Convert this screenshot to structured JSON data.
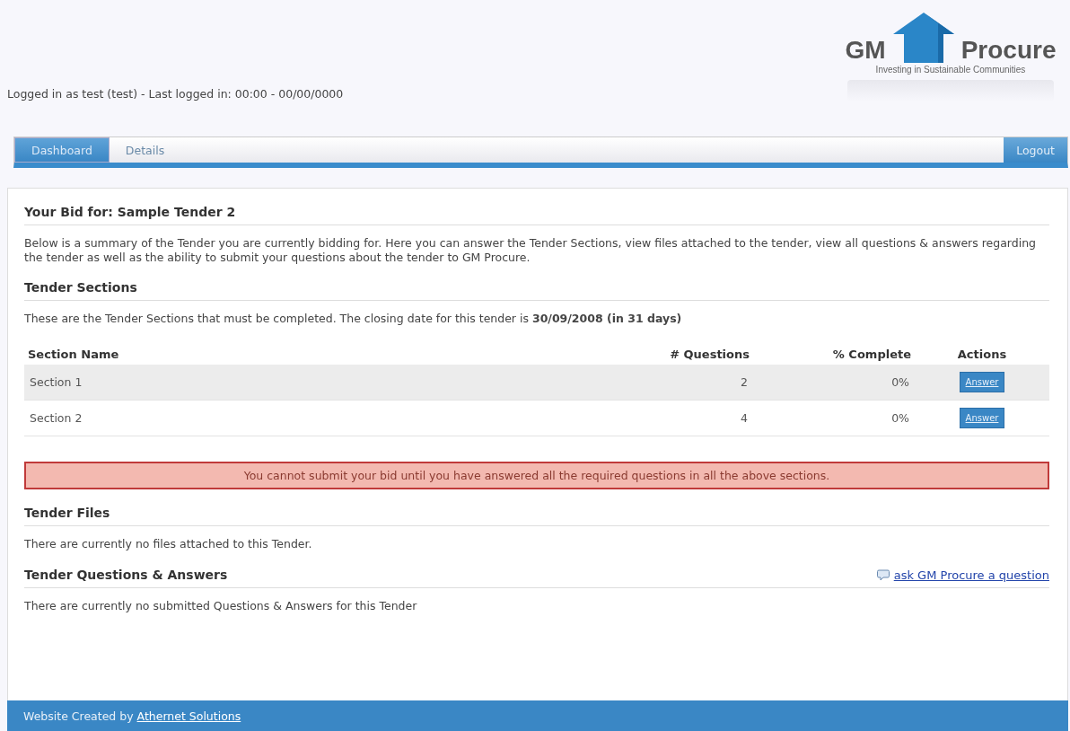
{
  "logo": {
    "name_left": "GM",
    "name_right": "Procure",
    "tagline": "Investing in Sustainable Communities"
  },
  "login_status": "Logged in as test (test) - Last logged in: 00:00 - 00/00/0000",
  "nav": {
    "tabs": [
      {
        "label": "Dashboard",
        "selected": true
      },
      {
        "label": "Details",
        "selected": false
      }
    ],
    "logout": "Logout"
  },
  "bid": {
    "title": "Your Bid for: Sample Tender 2",
    "summary": "Below is a summary of the Tender you are currently bidding for. Here you can answer the Tender Sections, view files attached to the tender, view all questions & answers regarding the tender as well as the ability to submit your questions about the tender to GM Procure."
  },
  "sections": {
    "title": "Tender Sections",
    "intro": "These are the Tender Sections that must be completed. The closing date for this tender is **30/09/2008 (in 31 days)**",
    "columns": [
      "Section Name",
      "# Questions",
      "% Complete",
      "Actions"
    ],
    "rows": [
      {
        "name": "Section 1",
        "questions": "2",
        "complete": "0%",
        "action": "Answer"
      },
      {
        "name": "Section 2",
        "questions": "4",
        "complete": "0%",
        "action": "Answer"
      }
    ]
  },
  "alert": "You cannot submit your bid until you have answered all the required questions in all the above sections.",
  "files": {
    "title": "Tender Files",
    "text": "There are currently no files attached to this Tender."
  },
  "qa": {
    "title": "Tender Questions & Answers",
    "ask_link": "ask GM Procure a question",
    "text": "There are currently no submitted Questions & Answers for this Tender"
  },
  "footer": {
    "text": "Website Created by",
    "link": "Athernet Solutions"
  }
}
